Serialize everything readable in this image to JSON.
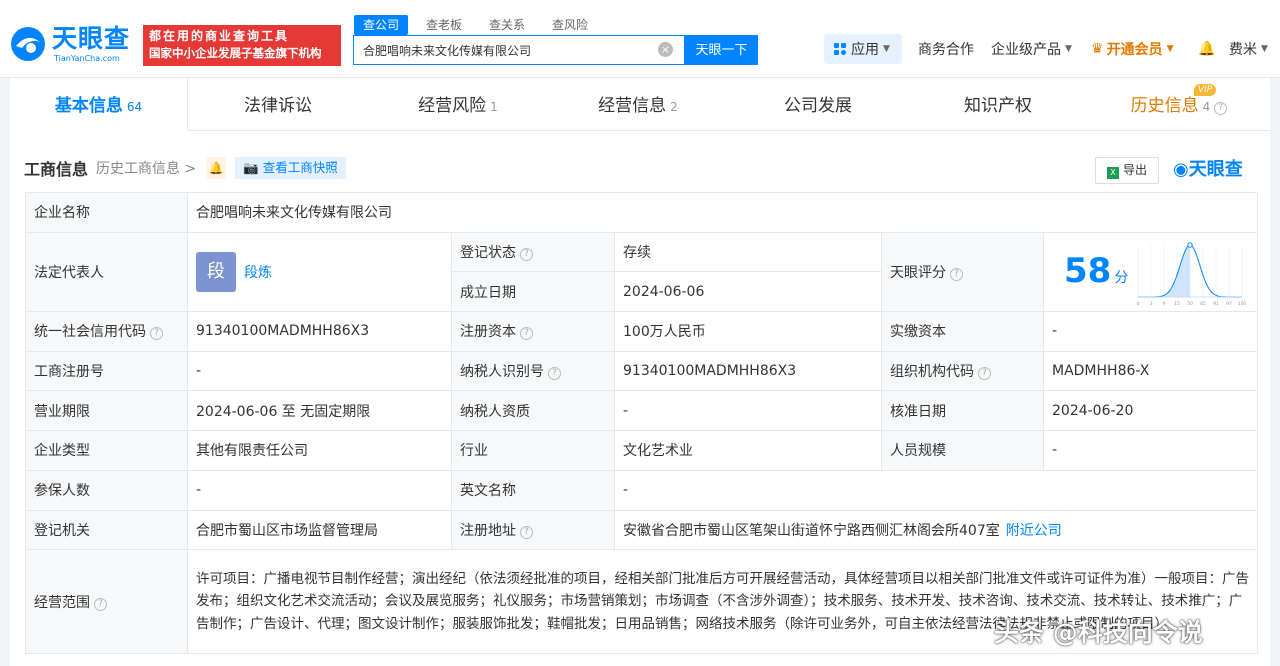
{
  "brand": {
    "name": "天眼查",
    "domain": "TianYanCha.com",
    "promo_line1": "都在用的商业查询工具",
    "promo_line2": "国家中小企业发展子基金旗下机构"
  },
  "search": {
    "tabs": [
      "查公司",
      "查老板",
      "查关系",
      "查风险"
    ],
    "active_tab": 0,
    "value": "合肥唱响未来文化传媒有限公司",
    "button": "天眼一下"
  },
  "topnav": {
    "apps": "应用",
    "business": "商务合作",
    "enterprise": "企业级产品",
    "vip": "开通会员",
    "user": "费米"
  },
  "tabs": [
    {
      "label": "基本信息",
      "count": "64"
    },
    {
      "label": "法律诉讼",
      "count": ""
    },
    {
      "label": "经营风险",
      "count": "1"
    },
    {
      "label": "经营信息",
      "count": "2"
    },
    {
      "label": "公司发展",
      "count": ""
    },
    {
      "label": "知识产权",
      "count": ""
    },
    {
      "label": "历史信息",
      "count": "4",
      "badge": "VIP"
    }
  ],
  "section": {
    "title": "工商信息",
    "history": "历史工商信息 >",
    "snapshot": "查看工商快照",
    "export": "导出",
    "brand_mark": "天眼查"
  },
  "info": {
    "company_name_label": "企业名称",
    "company_name": "合肥唱响未来文化传媒有限公司",
    "legal_rep_label": "法定代表人",
    "legal_rep_avatar": "段",
    "legal_rep": "段炼",
    "status_label": "登记状态",
    "status": "存续",
    "founded_label": "成立日期",
    "founded": "2024-06-06",
    "score_label": "天眼评分",
    "score": "58",
    "score_unit": "分",
    "credit_code_label": "统一社会信用代码",
    "credit_code": "91340100MADMHH86X3",
    "reg_capital_label": "注册资本",
    "reg_capital": "100万人民币",
    "paid_capital_label": "实缴资本",
    "paid_capital": "-",
    "reg_no_label": "工商注册号",
    "reg_no": "-",
    "tax_id_label": "纳税人识别号",
    "tax_id": "91340100MADMHH86X3",
    "org_code_label": "组织机构代码",
    "org_code": "MADMHH86-X",
    "term_label": "营业期限",
    "term": "2024-06-06 至 无固定期限",
    "tax_qual_label": "纳税人资质",
    "tax_qual": "-",
    "approve_label": "核准日期",
    "approve": "2024-06-20",
    "type_label": "企业类型",
    "type": "其他有限责任公司",
    "industry_label": "行业",
    "industry": "文化艺术业",
    "staff_label": "人员规模",
    "staff": "-",
    "insured_label": "参保人数",
    "insured": "-",
    "en_name_label": "英文名称",
    "en_name": "-",
    "authority_label": "登记机关",
    "authority": "合肥市蜀山区市场监督管理局",
    "address_label": "注册地址",
    "address": "安徽省合肥市蜀山区笔架山街道怀宁路西侧汇林阁会所407室",
    "nearby": "附近公司",
    "scope_label": "经营范围",
    "scope": "许可项目：广播电视节目制作经营；演出经纪（依法须经批准的项目，经相关部门批准后方可开展经营活动，具体经营项目以相关部门批准文件或许可证件为准）一般项目：广告发布；组织文化艺术交流活动；会议及展览服务；礼仪服务；市场营销策划；市场调查（不含涉外调查）；技术服务、技术开发、技术咨询、技术交流、技术转让、技术推广；广告制作；广告设计、代理；图文设计制作；服装服饰批发；鞋帽批发；日用品销售；网络技术服务（除许可业务外，可自主依法经营法律法规非禁止或限制的项目）"
  },
  "score_chart": {
    "ticks": [
      "0",
      "3",
      "9",
      "15",
      "50",
      "85",
      "91",
      "97",
      "100"
    ],
    "marker": 58
  },
  "watermark": "头条 @科技向令说",
  "colors": {
    "accent": "#0084ff",
    "promo": "#e53935",
    "status": "#1aa259",
    "vip": "#e07b00"
  }
}
